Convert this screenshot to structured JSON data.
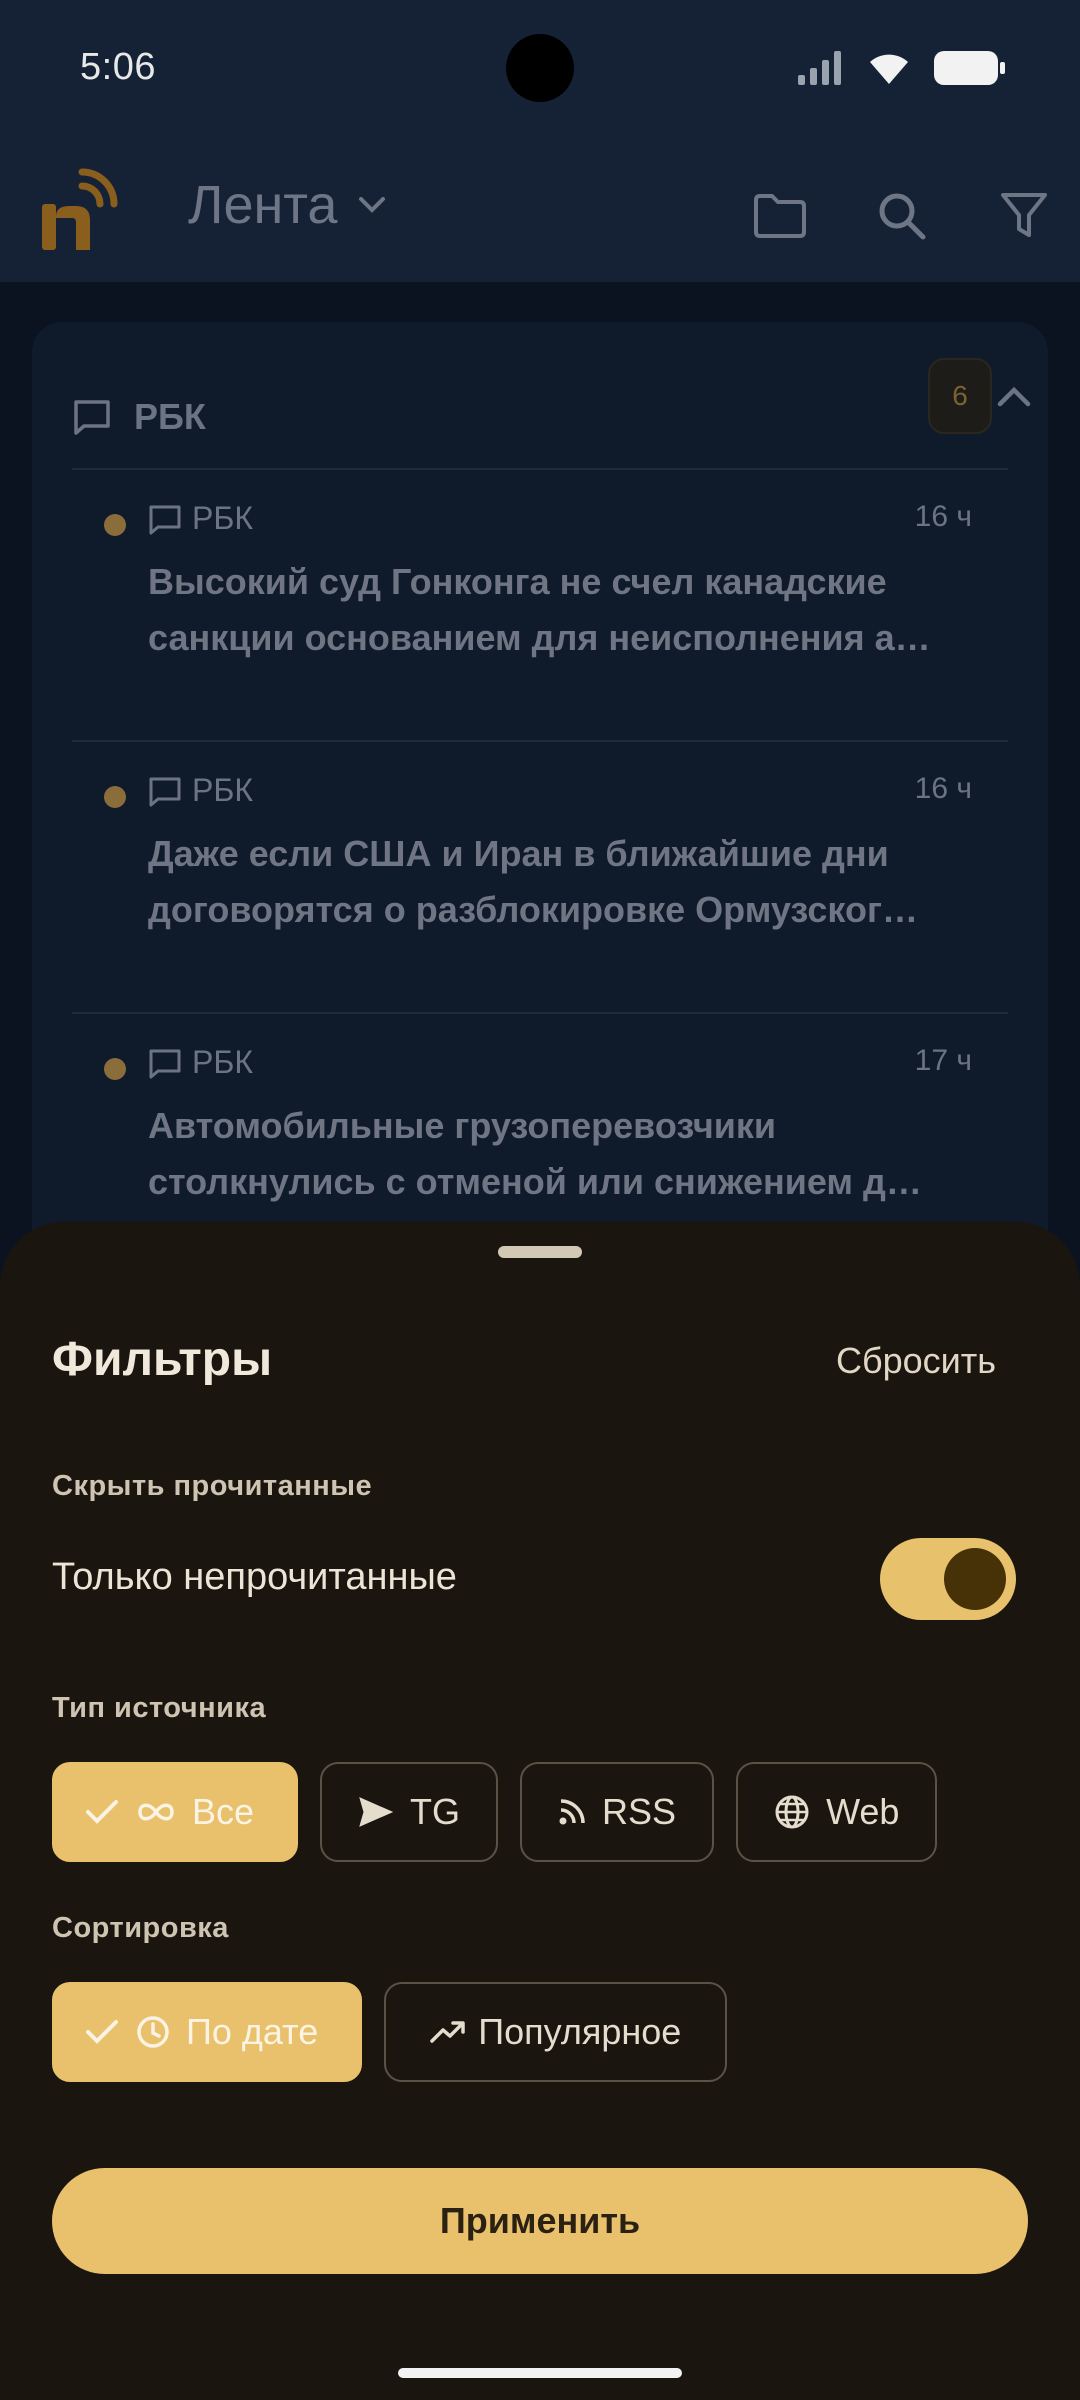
{
  "status_bar": {
    "time": "5:06",
    "icons": [
      "signal-icon",
      "wifi-icon",
      "battery-icon"
    ]
  },
  "app_bar": {
    "title": "Лента",
    "actions": [
      "folder-icon",
      "search-icon",
      "filter-icon"
    ]
  },
  "feed": {
    "group": {
      "name": "РБК",
      "unread_count": "6"
    },
    "items": [
      {
        "source": "РБК",
        "time": "16 ч",
        "title_line1": "Высокий суд Гонконга не счел канадские",
        "title_line2": "санкции основанием для неисполнения а…"
      },
      {
        "source": "РБК",
        "time": "16 ч",
        "title_line1": "Даже если США и Иран в ближайшие дни",
        "title_line2": "договорятся о разблокировке Ормузског…"
      },
      {
        "source": "РБК",
        "time": "17 ч",
        "title_line1": "Автомобильные грузоперевозчики",
        "title_line2": "столкнулись с отменой или снижением д…"
      }
    ]
  },
  "filters": {
    "title": "Фильтры",
    "reset_label": "Сбросить",
    "hide_read": {
      "section": "Скрыть прочитанные",
      "option": "Только непрочитанные",
      "enabled": true
    },
    "source_type": {
      "section": "Тип источника",
      "chips": [
        {
          "label": "Все",
          "icon": "infinity-icon",
          "selected": true
        },
        {
          "label": "TG",
          "icon": "send-icon",
          "selected": false
        },
        {
          "label": "RSS",
          "icon": "rss-icon",
          "selected": false
        },
        {
          "label": "Web",
          "icon": "globe-icon",
          "selected": false
        }
      ]
    },
    "sort": {
      "section": "Сортировка",
      "chips": [
        {
          "label": "По дате",
          "icon": "clock-icon",
          "selected": true
        },
        {
          "label": "Популярное",
          "icon": "trending-icon",
          "selected": false
        }
      ]
    },
    "apply_label": "Применить"
  },
  "colors": {
    "accent": "#e9c16c",
    "sheet_bg": "#1a150f",
    "feed_bg": "#0b1220"
  }
}
